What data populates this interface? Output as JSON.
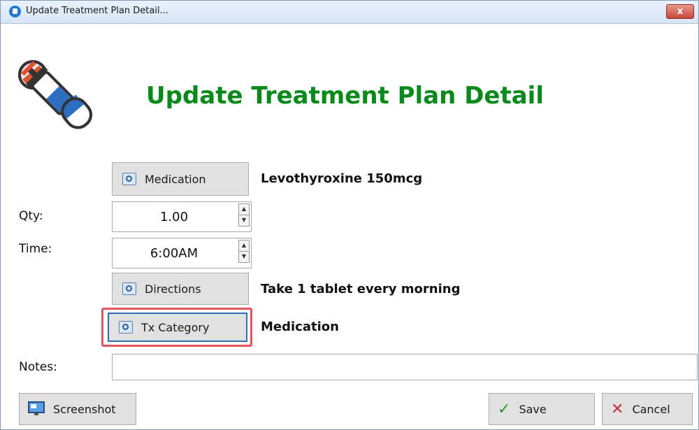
{
  "window": {
    "title": "Update Treatment Plan Detail...",
    "close_label": "x"
  },
  "header": {
    "title": "Update Treatment Plan Detail"
  },
  "medication": {
    "button_label": "Medication",
    "value": "Levothyroxine 150mcg"
  },
  "qty": {
    "label": "Qty:",
    "value": "1.00"
  },
  "time": {
    "label": "Time:",
    "value": "6:00AM"
  },
  "directions": {
    "button_label": "Directions",
    "value": "Take 1 tablet every morning"
  },
  "tx_category": {
    "button_label": "Tx Category",
    "value": "Medication"
  },
  "notes": {
    "label": "Notes:",
    "value": ""
  },
  "footer": {
    "screenshot_label": "Screenshot",
    "save_label": "Save",
    "cancel_label": "Cancel"
  },
  "colors": {
    "heading": "#0a8a1a",
    "highlight": "#e05560",
    "save_check": "#2a9d2a",
    "cancel_x": "#c8323c"
  },
  "icons": [
    "app-icon",
    "medication-hero-icon",
    "lookup-icon",
    "spin-up-icon",
    "spin-down-icon",
    "screenshot-icon",
    "check-icon",
    "x-icon"
  ]
}
